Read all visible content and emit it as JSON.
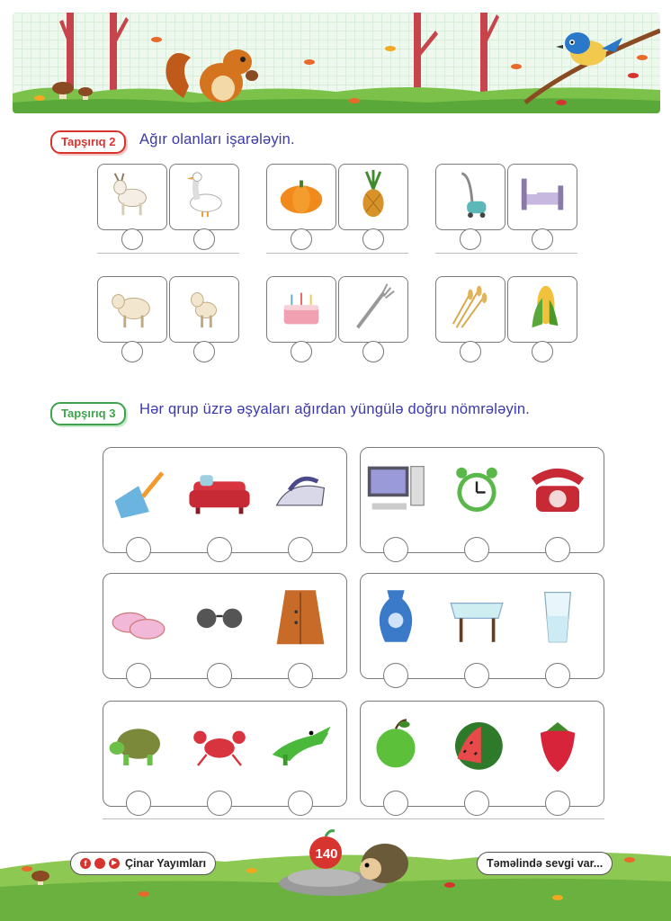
{
  "task2": {
    "tag": "Tapşırıq 2",
    "instruction": "Ağır olanları işarələyin.",
    "pairs": [
      [
        "goat",
        "goose"
      ],
      [
        "pumpkin",
        "pineapple"
      ],
      [
        "vacuum-cleaner",
        "bed"
      ],
      [
        "sheep",
        "lamb"
      ],
      [
        "cake",
        "fork"
      ],
      [
        "wheat",
        "corn"
      ]
    ]
  },
  "task3": {
    "tag": "Tapşırıq 3",
    "instruction": "Hər qrup üzrə əşyaları ağırdan yüngülə doğru nömrələyin.",
    "groups": [
      [
        "dustpan",
        "sofa",
        "iron"
      ],
      [
        "computer",
        "alarm-clock",
        "telephone"
      ],
      [
        "slippers",
        "sunglasses",
        "coat"
      ],
      [
        "vase",
        "table",
        "glass"
      ],
      [
        "turtle",
        "crab",
        "crocodile"
      ],
      [
        "apple",
        "watermelon",
        "strawberry"
      ]
    ]
  },
  "footer": {
    "publisher": "Çinar Yayımları",
    "page_number": "140",
    "slogan": "Təməlində sevgi var..."
  },
  "colors": {
    "accent_red": "#d8342f",
    "accent_green": "#3fa34d",
    "instruction_blue": "#3b3aa8"
  }
}
